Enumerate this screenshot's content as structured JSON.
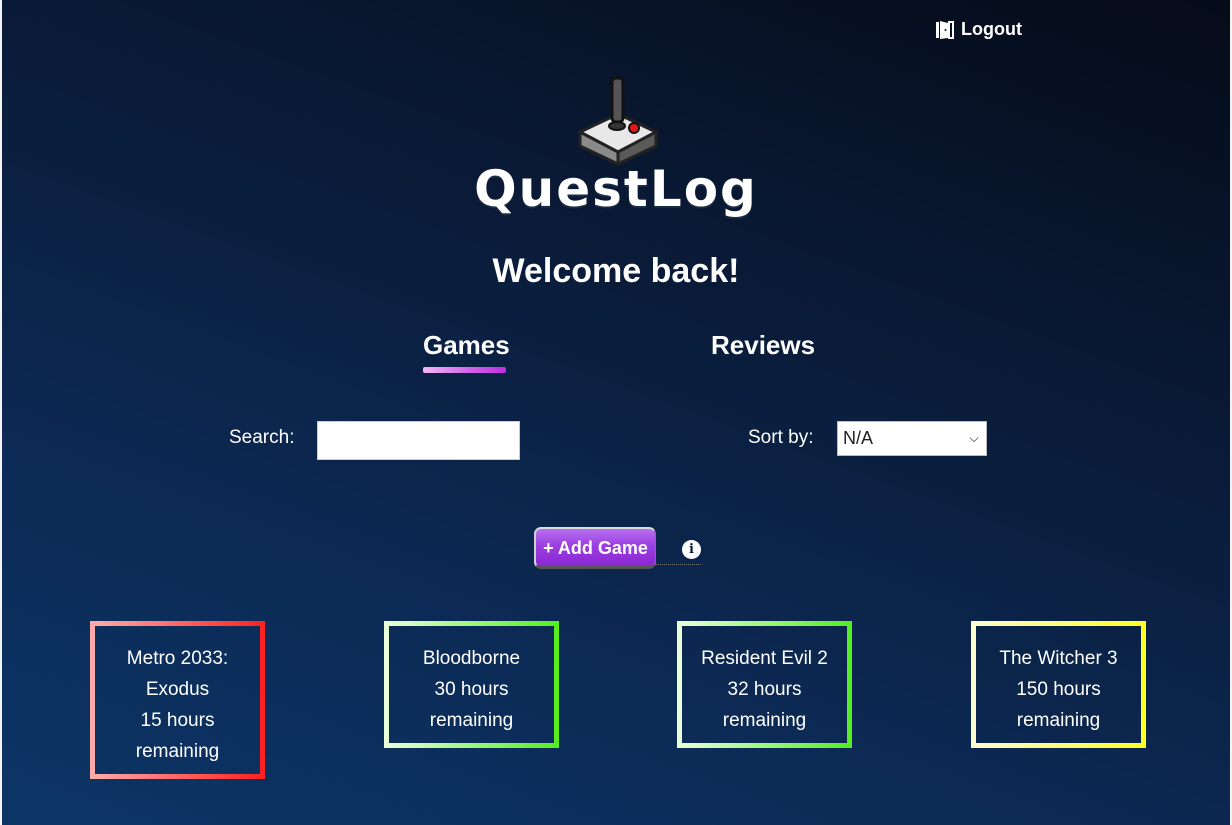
{
  "header": {
    "logout_label": "Logout",
    "logout_icon": "door-exit-icon"
  },
  "logo": {
    "text": "QuestLog",
    "icon": "joystick-icon"
  },
  "welcome": "Welcome back!",
  "tabs": [
    {
      "label": "Games",
      "active": true
    },
    {
      "label": "Reviews",
      "active": false
    }
  ],
  "search": {
    "label": "Search:",
    "value": ""
  },
  "sort": {
    "label": "Sort by:",
    "selected": "N/A"
  },
  "add_game": {
    "label": "+ Add Game",
    "info_icon": "info-icon"
  },
  "games": [
    {
      "title_line1": "Metro 2033:",
      "title_line2": "Exodus",
      "hours": "15 hours",
      "status": "remaining",
      "color": "#ff2222"
    },
    {
      "title_line1": "Bloodborne",
      "title_line2": "",
      "hours": "30 hours",
      "status": "remaining",
      "color": "#55ee22"
    },
    {
      "title_line1": "Resident Evil 2",
      "title_line2": "",
      "hours": "32 hours",
      "status": "remaining",
      "color": "#55ee22"
    },
    {
      "title_line1": "The Witcher 3",
      "title_line2": "",
      "hours": "150 hours",
      "status": "remaining",
      "color": "#ffff22"
    }
  ]
}
